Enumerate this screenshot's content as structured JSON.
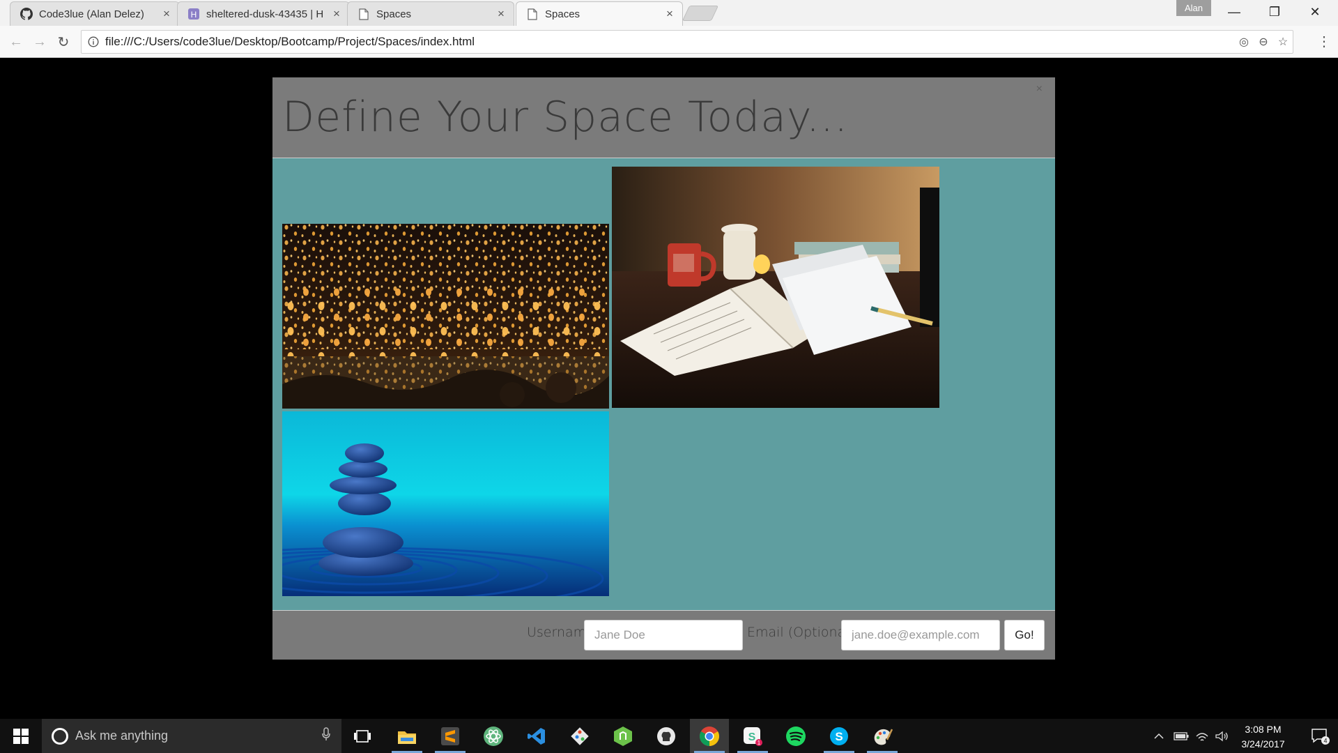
{
  "browser": {
    "tabs": [
      {
        "title": "Code3lue (Alan Delez)",
        "icon": "github-icon",
        "close": "×"
      },
      {
        "title": "sheltered-dusk-43435 | H",
        "icon": "heroku-icon",
        "close": "×"
      },
      {
        "title": "Spaces",
        "icon": "page-icon",
        "close": "×"
      },
      {
        "title": "Spaces",
        "icon": "page-icon",
        "close": "×",
        "active": true
      }
    ],
    "profile_name": "Alan",
    "window_controls": {
      "minimize": "—",
      "restore": "❐",
      "close": "✕"
    },
    "address": "file:///C:/Users/code3lue/Desktop/Bootcamp/Project/Spaces/index.html",
    "nav": {
      "back": "←",
      "forward": "→",
      "reload": "↻"
    },
    "omnibox_icons": {
      "location": "◎",
      "zoom": "⊖",
      "bookmark": "☆"
    },
    "menu": "⋮"
  },
  "page": {
    "modal": {
      "title": "Define Your Space Today...",
      "close": "×",
      "images": [
        {
          "name": "sky-lanterns-image",
          "subject": "crowd releasing glowing sky lanterns at night"
        },
        {
          "name": "desk-notebook-image",
          "subject": "desk with open notebook, mug, papers and pencil"
        },
        {
          "name": "zen-stones-image",
          "subject": "balanced blue stones on rippling water"
        }
      ],
      "footer": {
        "username_label": "Username",
        "username_placeholder": "Jane Doe",
        "email_label": "Email (Optional)",
        "email_placeholder": "jane.doe@example.com",
        "submit_label": "Go!"
      }
    },
    "colors": {
      "modal_header": "#7b7b7b",
      "modal_body": "#5f9ea0",
      "modal_footer": "#7a7a7a",
      "page_background": "#000000"
    }
  },
  "taskbar": {
    "search_placeholder": "Ask me anything",
    "apps": [
      "task-view-icon",
      "file-explorer-icon",
      "sublime-text-icon",
      "atom-icon",
      "vscode-icon",
      "git-icon",
      "node-icon",
      "github-desktop-icon",
      "chrome-icon",
      "slack-icon",
      "spotify-icon",
      "skype-icon",
      "paint-icon"
    ],
    "clock": {
      "time": "3:08 PM",
      "date": "3/24/2017"
    },
    "notification_count": "4"
  }
}
